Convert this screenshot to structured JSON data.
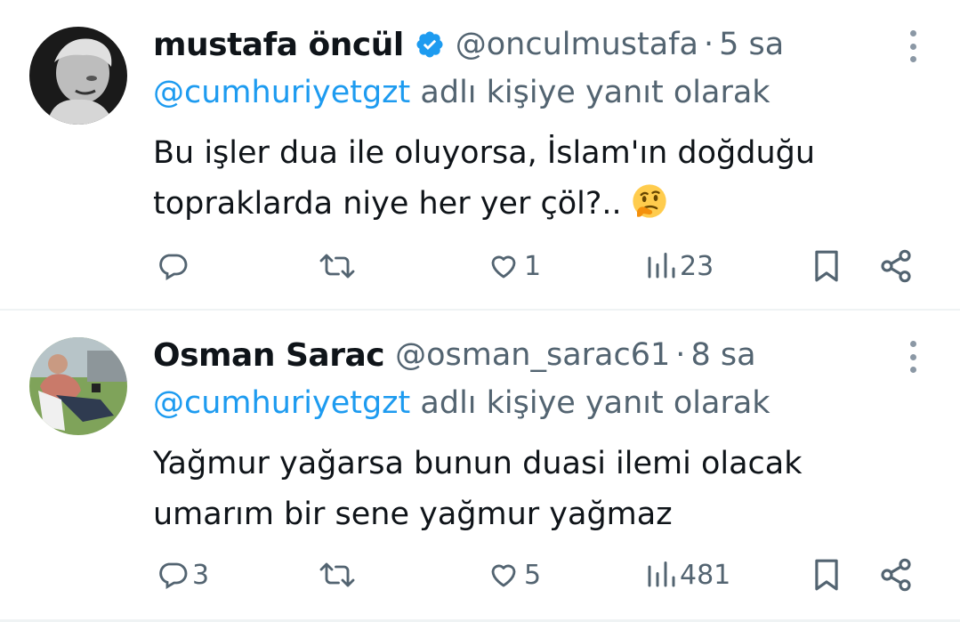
{
  "tweets": [
    {
      "name": "mustafa öncül",
      "verified": true,
      "handle": "@onculmustafa",
      "separator": "·",
      "time": "5 sa",
      "reply_mention": "@cumhuriyetgzt",
      "reply_suffix": " adlı kişiye yanıt olarak",
      "text_lines": [
        "Bu işler dua ile oluyorsa, İslam'ın doğduğu",
        "topraklarda niye her yer çöl?.."
      ],
      "emoji": "thinking-face-emoji",
      "actions": {
        "reply_count": "",
        "retweet_count": "",
        "like_count": "1",
        "view_count": "23"
      }
    },
    {
      "name": "Osman Sarac",
      "verified": false,
      "handle": "@osman_sarac61",
      "separator": "·",
      "time": "8 sa",
      "reply_mention": "@cumhuriyetgzt",
      "reply_suffix": " adlı kişiye yanıt olarak",
      "text_lines": [
        "Yağmur yağarsa bunun duasi ilemi olacak",
        "umarım bir sene yağmur yağmaz"
      ],
      "actions": {
        "reply_count": "3",
        "retweet_count": "",
        "like_count": "5",
        "view_count": "481"
      }
    }
  ],
  "colors": {
    "text_primary": "#0f1419",
    "text_secondary": "#536471",
    "accent": "#1d9bf0",
    "divider": "#eff3f4"
  },
  "icons": [
    "verified-badge-icon",
    "more-options-icon",
    "reply-icon",
    "retweet-icon",
    "like-icon",
    "views-icon",
    "bookmark-icon",
    "share-icon"
  ]
}
